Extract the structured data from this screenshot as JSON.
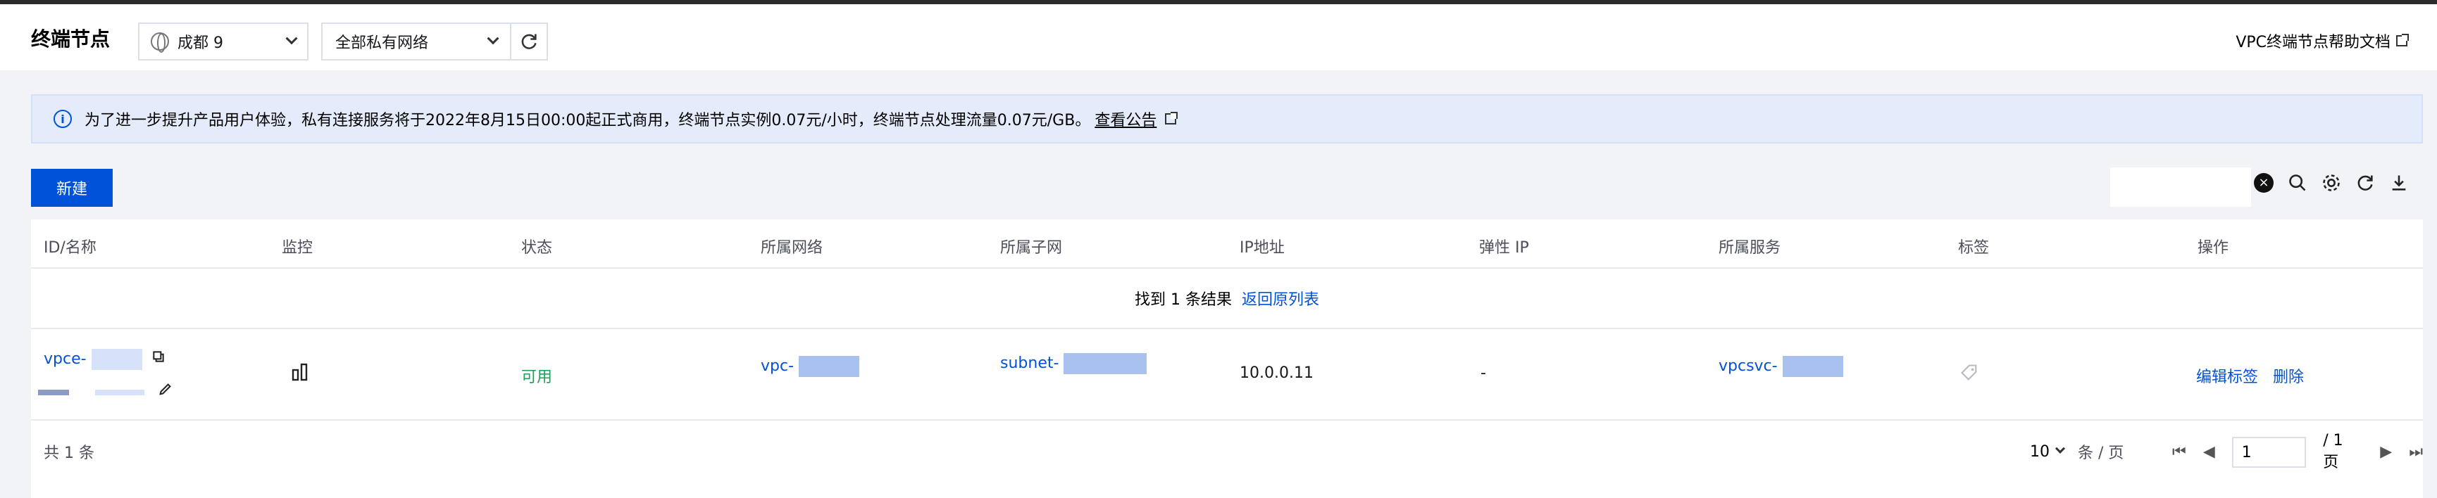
{
  "header": {
    "title": "终端节点",
    "region": "成都 9",
    "vpc_filter": "全部私有网络",
    "help_link": "VPC终端节点帮助文档"
  },
  "notice": {
    "text": "为了进一步提升产品用户体验，私有连接服务将于2022年8月15日00:00起正式商用，终端节点实例0.07元/小时，终端节点处理流量0.07元/GB。",
    "link": "查看公告"
  },
  "toolbar": {
    "new_label": "新建",
    "search_value": ""
  },
  "table": {
    "columns": [
      "ID/名称",
      "监控",
      "状态",
      "所属网络",
      "所属子网",
      "IP地址",
      "弹性 IP",
      "所属服务",
      "标签",
      "操作"
    ],
    "found_text": "找到 1 条结果",
    "back_link": "返回原列表",
    "row": {
      "id": "vpce-",
      "status": "可用",
      "vpc": "vpc-",
      "subnet": "subnet-",
      "ip": "10.0.0.11",
      "eip": "-",
      "service": "vpcsvc-",
      "action_edit_tags": "编辑标签",
      "action_delete": "删除"
    }
  },
  "footer": {
    "total": "共 1 条",
    "page_size": "10",
    "per_page": "条 / 页",
    "page_input": "1",
    "page_total": "/ 1 页"
  },
  "colors": {
    "primary": "#0052d9",
    "success": "#1aa15a",
    "notice_bg": "#e4ecfb"
  }
}
